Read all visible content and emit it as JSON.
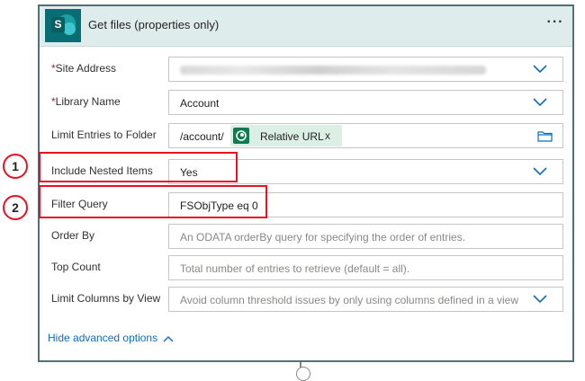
{
  "card": {
    "title": "Get files (properties only)",
    "menu_glyph": "···",
    "icon": "sharepoint-icon",
    "icon_letter": "S"
  },
  "fields": [
    {
      "label": "Site Address",
      "required": "*",
      "value": "",
      "placeholder": "",
      "kind": "dropdown",
      "value_obscured": true
    },
    {
      "label": "Library Name",
      "required": "*",
      "value": "Account",
      "placeholder": "",
      "kind": "dropdown"
    },
    {
      "label": "Limit Entries to Folder",
      "required": "",
      "value": "/account/",
      "token": "Relative URL",
      "token_close": "x",
      "kind": "folder-picker"
    },
    {
      "label": "Include Nested Items",
      "required": "",
      "value": "Yes",
      "placeholder": "",
      "kind": "dropdown"
    },
    {
      "label": "Filter Query",
      "required": "",
      "value": "FSObjType eq 0",
      "placeholder": "",
      "kind": "text"
    },
    {
      "label": "Order By",
      "required": "",
      "value": "",
      "placeholder": "An ODATA orderBy query for specifying the order of entries.",
      "kind": "text"
    },
    {
      "label": "Top Count",
      "required": "",
      "value": "",
      "placeholder": "Total number of entries to retrieve (default = all).",
      "kind": "text"
    },
    {
      "label": "Limit Columns by View",
      "required": "",
      "value": "",
      "placeholder": "Avoid column threshold issues by only using columns defined in a view",
      "kind": "dropdown"
    }
  ],
  "annotations": [
    {
      "number": "1"
    },
    {
      "number": "2"
    }
  ],
  "hide_advanced": "Hide advanced options",
  "colors": {
    "header_bg": "#dfecec",
    "sharepoint": "#076f73",
    "accent_blue": "#0f6cbd",
    "annotation_red": "#e81123",
    "required_red": "#a4262c",
    "token_bg": "#dcefe4"
  }
}
